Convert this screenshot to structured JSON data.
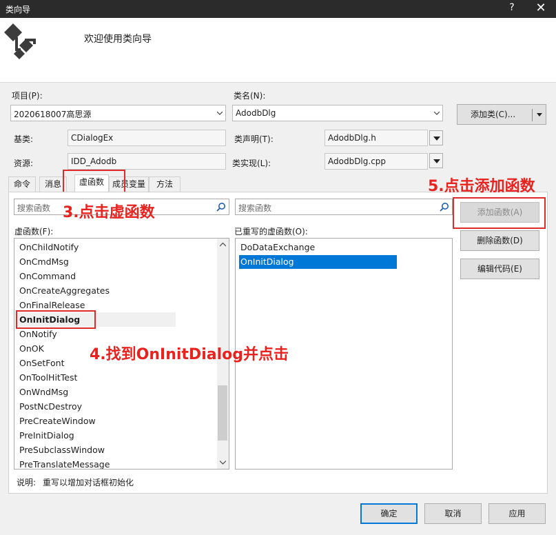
{
  "window": {
    "title": "类向导",
    "help": "?",
    "close": "✕"
  },
  "header": {
    "welcome": "欢迎使用类向导"
  },
  "project": {
    "label": "项目(P):",
    "value": "2020618007高思源"
  },
  "classname": {
    "label": "类名(N):",
    "value": "AdodbDlg"
  },
  "add_class_button": "添加类(C)...",
  "base": {
    "label": "基类:",
    "value": "CDialogEx"
  },
  "decl": {
    "label": "类声明(T):",
    "value": "AdodbDlg.h"
  },
  "resource": {
    "label": "资源:",
    "value": "IDD_Adodb"
  },
  "impl": {
    "label": "类实现(L):",
    "value": "AdodbDlg.cpp"
  },
  "tabs": [
    "命令",
    "消息",
    "虚函数",
    "成员变量",
    "方法"
  ],
  "search": {
    "left_placeholder": "搜索函数",
    "right_placeholder": "搜索函数"
  },
  "virtual_label": "虚函数(F):",
  "overridden_label": "已重写的虚函数(O):",
  "virtual_functions": [
    "OnChildNotify",
    "OnCmdMsg",
    "OnCommand",
    "OnCreateAggregates",
    "OnFinalRelease",
    "OnInitDialog",
    "OnNotify",
    "OnOK",
    "OnSetFont",
    "OnToolHitTest",
    "OnWndMsg",
    "PostNcDestroy",
    "PreCreateWindow",
    "PreInitDialog",
    "PreSubclassWindow",
    "PreTranslateMessage"
  ],
  "overridden_functions": [
    "DoDataExchange",
    "OnInitDialog"
  ],
  "buttons": {
    "add_function": "添加函数(A)",
    "delete_function": "删除函数(D)",
    "edit_code": "编辑代码(E)"
  },
  "description": {
    "label": "说明:",
    "text": "重写以增加对话框初始化"
  },
  "footer": {
    "ok": "确定",
    "cancel": "取消",
    "apply": "应用"
  },
  "annotations": {
    "a3": "3.点击虚函数",
    "a4": "4.找到OnInitDialog并点击",
    "a5": "5.点击添加函数"
  },
  "colors": {
    "selection": "#0078d7",
    "annotation": "#e8231f"
  }
}
